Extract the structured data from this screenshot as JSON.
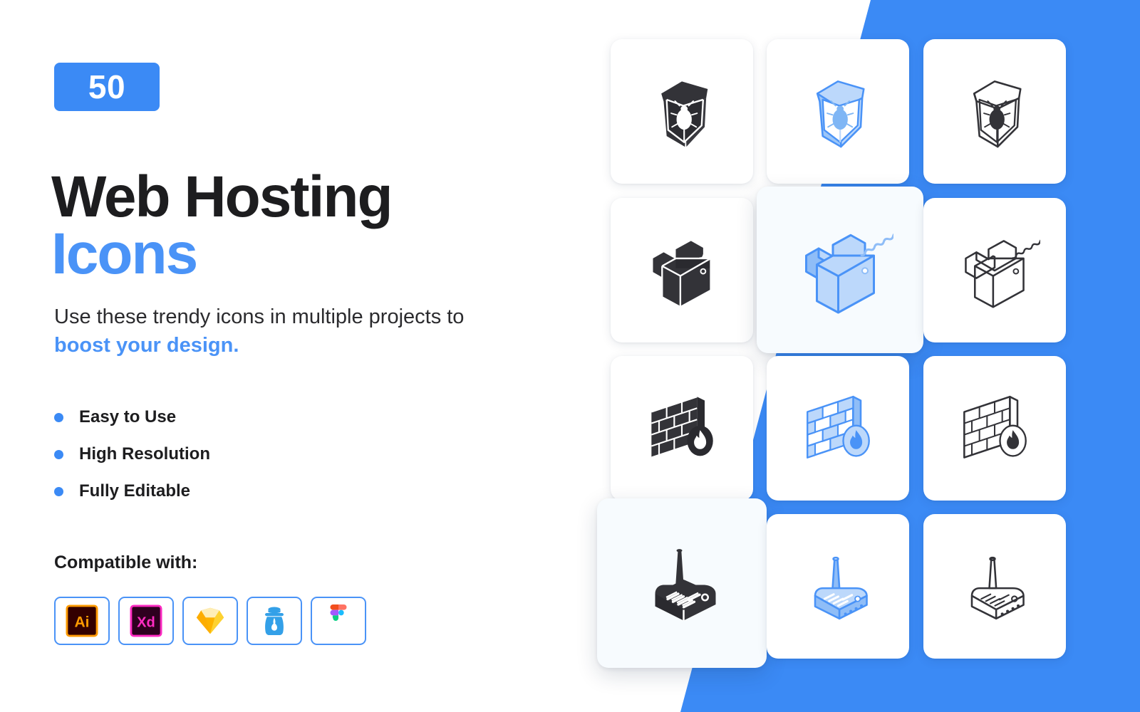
{
  "brand": {
    "accent_blue": "#3b8af5",
    "accent_blue_light": "#4a93f7",
    "icon_blue_fill": "#a8cdfa",
    "icon_blue_stroke": "#4a93f7",
    "dark": "#333338",
    "card_bg": "#ffffff",
    "card_raised_bg": "#f7fbfe"
  },
  "hero": {
    "badge_count": "50",
    "title_line1": "Web Hosting",
    "title_line2": "Icons",
    "subtitle_plain": "Use these trendy icons in multiple projects to ",
    "subtitle_accent": "boost your design."
  },
  "features": [
    {
      "label": "Easy to Use",
      "bullet_icon": "bullet-dot-icon"
    },
    {
      "label": "High Resolution",
      "bullet_icon": "bullet-dot-icon"
    },
    {
      "label": "Fully Editable",
      "bullet_icon": "bullet-dot-icon"
    }
  ],
  "compatibility": {
    "title": "Compatible with:",
    "apps": [
      {
        "name": "Adobe Illustrator",
        "short": "Ai",
        "icon": "adobe-illustrator-icon",
        "fg": "#ff9a00",
        "bg": "#330000"
      },
      {
        "name": "Adobe XD",
        "short": "Xd",
        "icon": "adobe-xd-icon",
        "fg": "#ff2bc2",
        "bg": "#2e001f"
      },
      {
        "name": "Sketch",
        "short": "",
        "icon": "sketch-icon",
        "fg": "#fdb300",
        "bg": "#ffffff"
      },
      {
        "name": "Inkscape",
        "short": "",
        "icon": "inkscape-jar-icon",
        "fg": "#33a0e8",
        "bg": "#ffffff"
      },
      {
        "name": "Figma",
        "short": "",
        "icon": "figma-icon",
        "fg": "#a259ff",
        "bg": "#ffffff"
      }
    ]
  },
  "icon_grid": {
    "columns": 3,
    "rows": 4,
    "style_names": [
      "solid-glyph",
      "blue-duotone",
      "line-outline"
    ],
    "cells": [
      {
        "icon": "shield-bug-icon",
        "label": "Shield Bug",
        "style": "solid-glyph",
        "raised": false
      },
      {
        "icon": "shield-bug-icon",
        "label": "Shield Bug",
        "style": "blue-duotone",
        "raised": false
      },
      {
        "icon": "shield-bug-icon",
        "label": "Shield Bug",
        "style": "line-outline",
        "raised": false
      },
      {
        "icon": "zip-folder-icon",
        "label": "Zip Folder",
        "style": "solid-glyph",
        "raised": false
      },
      {
        "icon": "zip-folder-icon",
        "label": "Zip Folder",
        "style": "blue-duotone",
        "raised": true
      },
      {
        "icon": "zip-folder-icon",
        "label": "Zip Folder",
        "style": "line-outline",
        "raised": false
      },
      {
        "icon": "firewall-icon",
        "label": "Firewall",
        "style": "solid-glyph",
        "raised": false
      },
      {
        "icon": "firewall-icon",
        "label": "Firewall",
        "style": "blue-duotone",
        "raised": false
      },
      {
        "icon": "firewall-icon",
        "label": "Firewall",
        "style": "line-outline",
        "raised": false
      },
      {
        "icon": "wifi-router-icon",
        "label": "Wifi Router",
        "style": "solid-glyph",
        "raised": true
      },
      {
        "icon": "wifi-router-icon",
        "label": "Wifi Router",
        "style": "blue-duotone",
        "raised": false
      },
      {
        "icon": "wifi-router-icon",
        "label": "Wifi Router",
        "style": "line-outline",
        "raised": false
      }
    ]
  }
}
